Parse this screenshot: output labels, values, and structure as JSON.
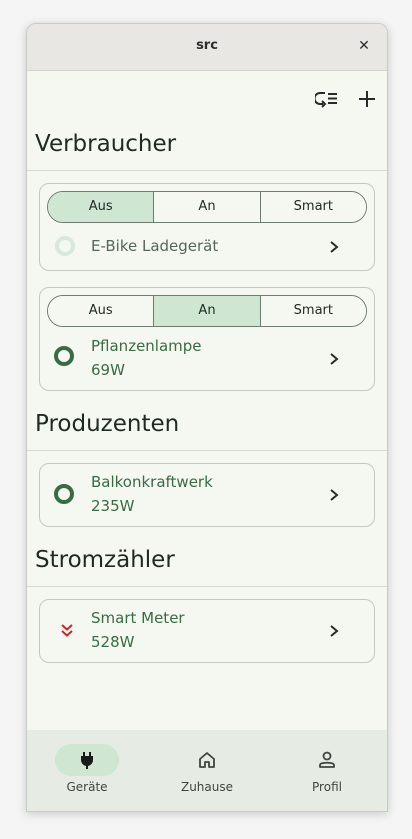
{
  "window": {
    "title": "src",
    "close_icon": "close-icon"
  },
  "toolbar": {
    "sort_icon": "list-sort-icon",
    "add_icon": "add-icon"
  },
  "sections": {
    "consumers": "Verbraucher",
    "producers": "Produzenten",
    "meters": "Stromzähler"
  },
  "mode_options": [
    "Aus",
    "An",
    "Smart"
  ],
  "consumers": [
    {
      "name": "E-Bike Ladegerät",
      "mode": "Aus",
      "status": "off",
      "watt": ""
    },
    {
      "name": "Pflanzenlampe",
      "mode": "An",
      "status": "on",
      "watt": "69W"
    }
  ],
  "producers": [
    {
      "name": "Balkonkraftwerk",
      "status": "on",
      "watt": "235W"
    }
  ],
  "meters": [
    {
      "name": "Smart Meter",
      "watt": "528W",
      "icon": "double-chevron-down-icon",
      "icon_color": "#c62828"
    }
  ],
  "nav": [
    {
      "label": "Geräte",
      "icon": "plug-icon",
      "active": true
    },
    {
      "label": "Zuhause",
      "icon": "home-icon",
      "active": false
    },
    {
      "label": "Profil",
      "icon": "person-icon",
      "active": false
    }
  ],
  "colors": {
    "accent": "#3a6b47",
    "selected": "#cfe6d3",
    "background": "#f4f8f1"
  }
}
